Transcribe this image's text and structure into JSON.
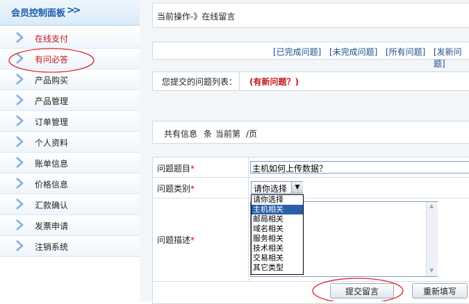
{
  "sidebar": {
    "title": "会员控制面板",
    "title_arrow": ">>",
    "items": [
      {
        "label": "在线支付",
        "red": true
      },
      {
        "label": "有问必答",
        "red": true
      },
      {
        "label": "产品购买",
        "red": false
      },
      {
        "label": "产品管理",
        "red": false
      },
      {
        "label": "订单管理",
        "red": false
      },
      {
        "label": "个人资料",
        "red": false
      },
      {
        "label": "账单信息",
        "red": false
      },
      {
        "label": "价格信息",
        "red": false
      },
      {
        "label": "汇款确认",
        "red": false
      },
      {
        "label": "发票申请",
        "red": false
      },
      {
        "label": "注销系统",
        "red": false
      }
    ]
  },
  "main": {
    "breadcrumb": "当前操作-》在线留言",
    "links": [
      "[已完成问题]",
      "[未完成问题]",
      "[所有问题]",
      "[发新问题]"
    ],
    "list_label": "您提交的问题列表：",
    "new_question": "(有新问题？)",
    "pagination": {
      "text1": "共有信息",
      "text2": "条",
      "text3": "当前第",
      "text4": "/页"
    },
    "form": {
      "title_label": "问题题目",
      "title_value": "主机如何上传数据？",
      "category_label": "问题类别",
      "category_selected": "请你选择",
      "category_options": [
        "请你选择",
        "主机相关",
        "邮局相关",
        "域名相关",
        "服务相关",
        "技术相关",
        "交易相关",
        "其它类型"
      ],
      "highlighted_option": 1,
      "desc_label": "问题描述",
      "required_mark": "*",
      "submit_label": "提交留言",
      "reset_label": "重新填写"
    }
  },
  "colors": {
    "accent": "#1a5aa8",
    "annotation_red": "#e0252b",
    "selected_option": "#2b5ea8"
  }
}
